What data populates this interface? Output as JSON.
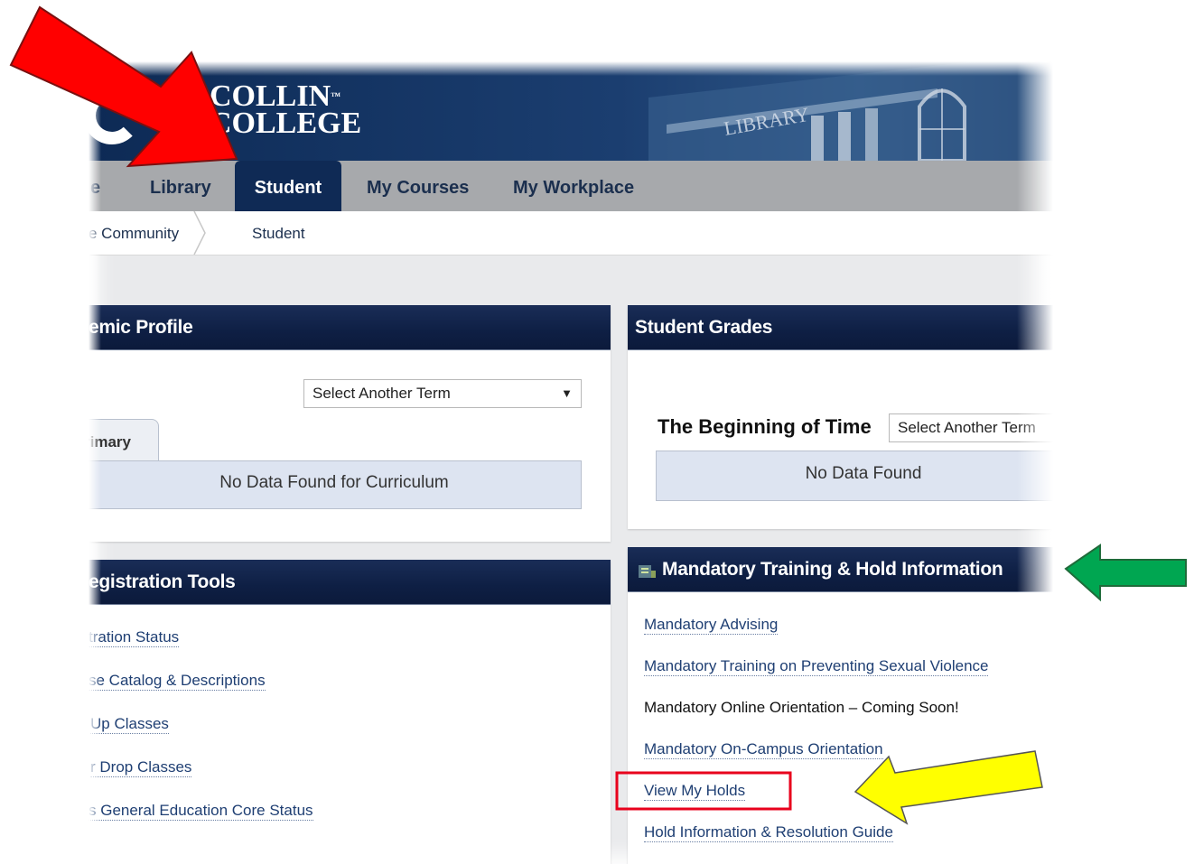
{
  "header": {
    "logo_line1": "COLLIN",
    "logo_tm": "™",
    "logo_line2": "COLLEGE",
    "building_sign": "LIBRARY"
  },
  "nav": {
    "items": [
      {
        "label": "e"
      },
      {
        "label": "Library"
      },
      {
        "label": "Student"
      },
      {
        "label": "My Courses"
      },
      {
        "label": "My Workplace"
      }
    ],
    "active": "Student"
  },
  "breadcrumb": {
    "items": [
      {
        "label": "e Community"
      },
      {
        "label": "Student"
      }
    ]
  },
  "academic_profile": {
    "title": "emic Profile",
    "term_select": "Select Another Term",
    "tab_label": "rimary",
    "no_data": "No Data Found for Curriculum"
  },
  "student_grades": {
    "title": "Student Grades",
    "term_heading": "The Beginning of Time",
    "term_select": "Select Another Term",
    "no_data": "No Data Found"
  },
  "registration_tools": {
    "title": "egistration Tools",
    "links": [
      {
        "label": "tration Status"
      },
      {
        "label": "se Catalog & Descriptions"
      },
      {
        "label": "Up Classes"
      },
      {
        "label": "r Drop Classes"
      },
      {
        "label": "s General Education Core Status"
      }
    ]
  },
  "mandatory": {
    "title": "Mandatory Training & Hold Information",
    "links": [
      {
        "label": "Mandatory Advising",
        "link": true
      },
      {
        "label": "Mandatory Training on Preventing Sexual Violence",
        "link": true
      },
      {
        "label": "Mandatory Online Orientation – Coming Soon!",
        "link": false
      },
      {
        "label": "Mandatory On-Campus Orientation",
        "link": true
      },
      {
        "label": "View My Holds",
        "link": true,
        "highlighted": true
      },
      {
        "label": "Hold Information & Resolution Guide",
        "link": true
      }
    ]
  },
  "annotations": {
    "red_arrow_color": "#ff0000",
    "green_arrow_color": "#00a651",
    "yellow_arrow_color": "#ffff00",
    "highlight_box_color": "#e8001c"
  }
}
